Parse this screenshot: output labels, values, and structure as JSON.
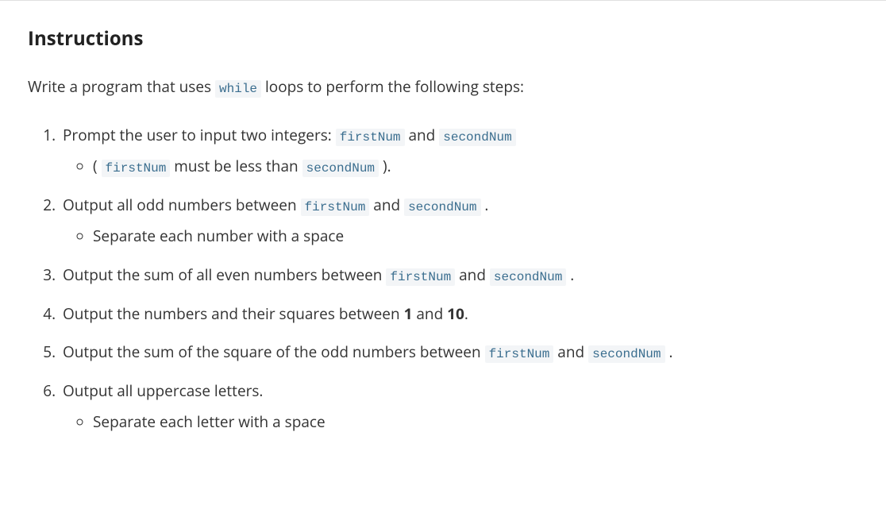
{
  "heading": "Instructions",
  "intro": {
    "prefix": "Write a program that uses ",
    "code": "while",
    "suffix": " loops to perform the following steps:"
  },
  "steps": {
    "s1": {
      "t1": "Prompt the user to input two integers: ",
      "c1": "firstNum",
      "t2": " and ",
      "c2": "secondNum",
      "sub": {
        "t1": "( ",
        "c1": "firstNum",
        "t2": " must be less than ",
        "c2": "secondNum",
        "t3": " )."
      }
    },
    "s2": {
      "t1": "Output all odd numbers between ",
      "c1": "firstNum",
      "t2": " and ",
      "c2": "secondNum",
      "t3": " .",
      "sub": "Separate each number with a space"
    },
    "s3": {
      "t1": "Output the sum of all even numbers between ",
      "c1": "firstNum",
      "t2": " and ",
      "c2": "secondNum",
      "t3": " ."
    },
    "s4": {
      "t1": "Output the numbers and their squares between ",
      "b1": "1",
      "t2": " and ",
      "b2": "10",
      "t3": "."
    },
    "s5": {
      "t1": "Output the sum of the square of the odd numbers between ",
      "c1": "firstNum",
      "t2": " and ",
      "c2": "secondNum",
      "t3": " ."
    },
    "s6": {
      "t1": "Output all uppercase letters.",
      "sub": "Separate each letter with a space"
    }
  }
}
